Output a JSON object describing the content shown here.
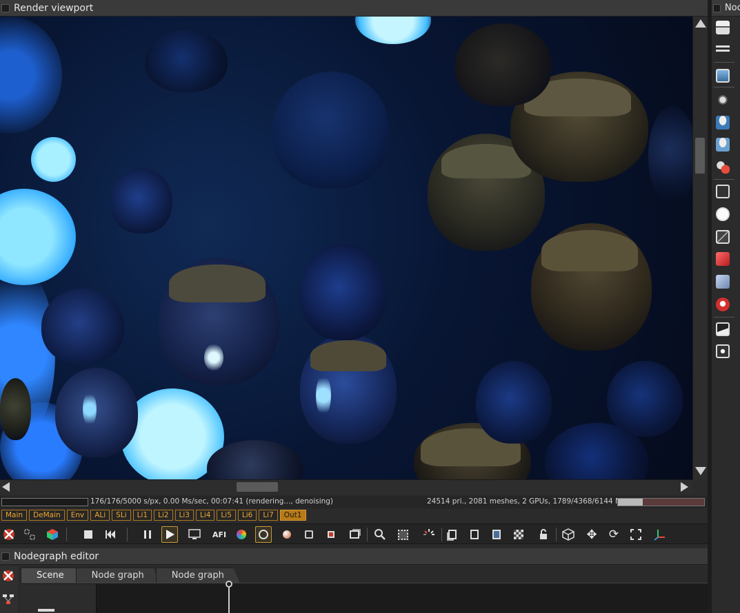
{
  "render_viewport": {
    "title": "Render viewport"
  },
  "nodes_panel": {
    "title": "Noc"
  },
  "status": {
    "render_info": "176/176/5000 s/px, 0.00 Ms/sec, 00:07:41 (rendering..., denoising)",
    "scene_info": "24514 pri., 2081 meshes, 2 GPUs, 1789/4368/6144 MB",
    "memory_fraction": 0.29
  },
  "passes": [
    "Main",
    "DeMain",
    "Env",
    "ALi",
    "SLi",
    "Li1",
    "Li2",
    "Li3",
    "Li4",
    "Li5",
    "Li6",
    "Li7",
    "Out1"
  ],
  "active_pass": "Out1",
  "toolbar": {
    "icons": [
      "render-settings-icon",
      "region-icon",
      "color-cube-icon",
      "stop-icon",
      "restart-icon",
      "pause-icon",
      "play-icon",
      "display-icon",
      "afi-text",
      "color-wheel-icon",
      "focus-icon",
      "pick-material-icon",
      "pick-object-icon",
      "pick-region-icon",
      "layer-icon",
      "zoom-icon",
      "region-select-icon",
      "spinner-icon",
      "copy-icon",
      "export-icon",
      "upload-icon",
      "checker-icon",
      "lock-icon",
      "cube-view-icon",
      "move-icon",
      "rotate-icon",
      "fit-icon",
      "axis-icon"
    ],
    "afi_label": "AFI"
  },
  "nodegraph": {
    "title": "Nodegraph editor",
    "tabs": [
      "Scene",
      "Node graph",
      "Node graph"
    ]
  },
  "colors": {
    "accent": "#b87a16",
    "pass_text": "#f0a732"
  }
}
